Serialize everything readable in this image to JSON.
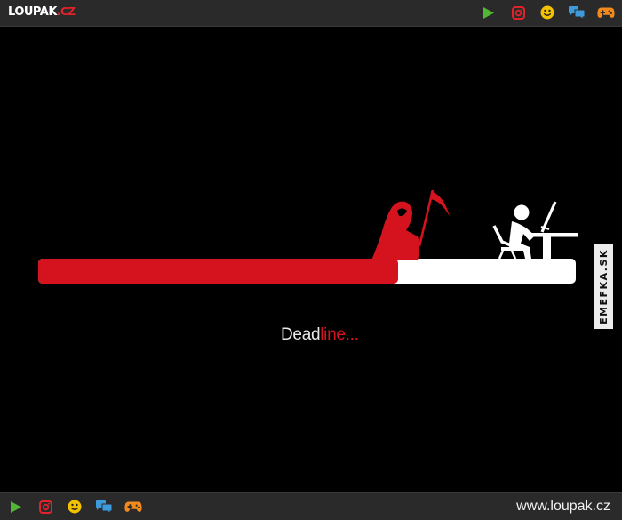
{
  "header": {
    "logo_main": "LOUPAK",
    "logo_tld": ".CZ",
    "icons": [
      "play-icon",
      "instagram-icon",
      "smiley-icon",
      "chat-icon",
      "gamepad-icon"
    ]
  },
  "image": {
    "caption_part1": "Dead",
    "caption_part2": "line...",
    "progress": 0.67,
    "watermark": "EMEFKA.SK",
    "colors": {
      "fill": "#d4131f",
      "track": "#ffffff",
      "background": "#000000"
    }
  },
  "footer": {
    "url": "www.loupak.cz",
    "icons": [
      "play-icon",
      "instagram-icon",
      "smiley-icon",
      "chat-icon",
      "gamepad-icon"
    ]
  },
  "colors": {
    "bar": "#2a2a2a",
    "play": "#52b733",
    "instagram": "#e2222a",
    "smiley": "#f2c200",
    "chat": "#3d9bdc",
    "gamepad": "#f28a1c"
  }
}
